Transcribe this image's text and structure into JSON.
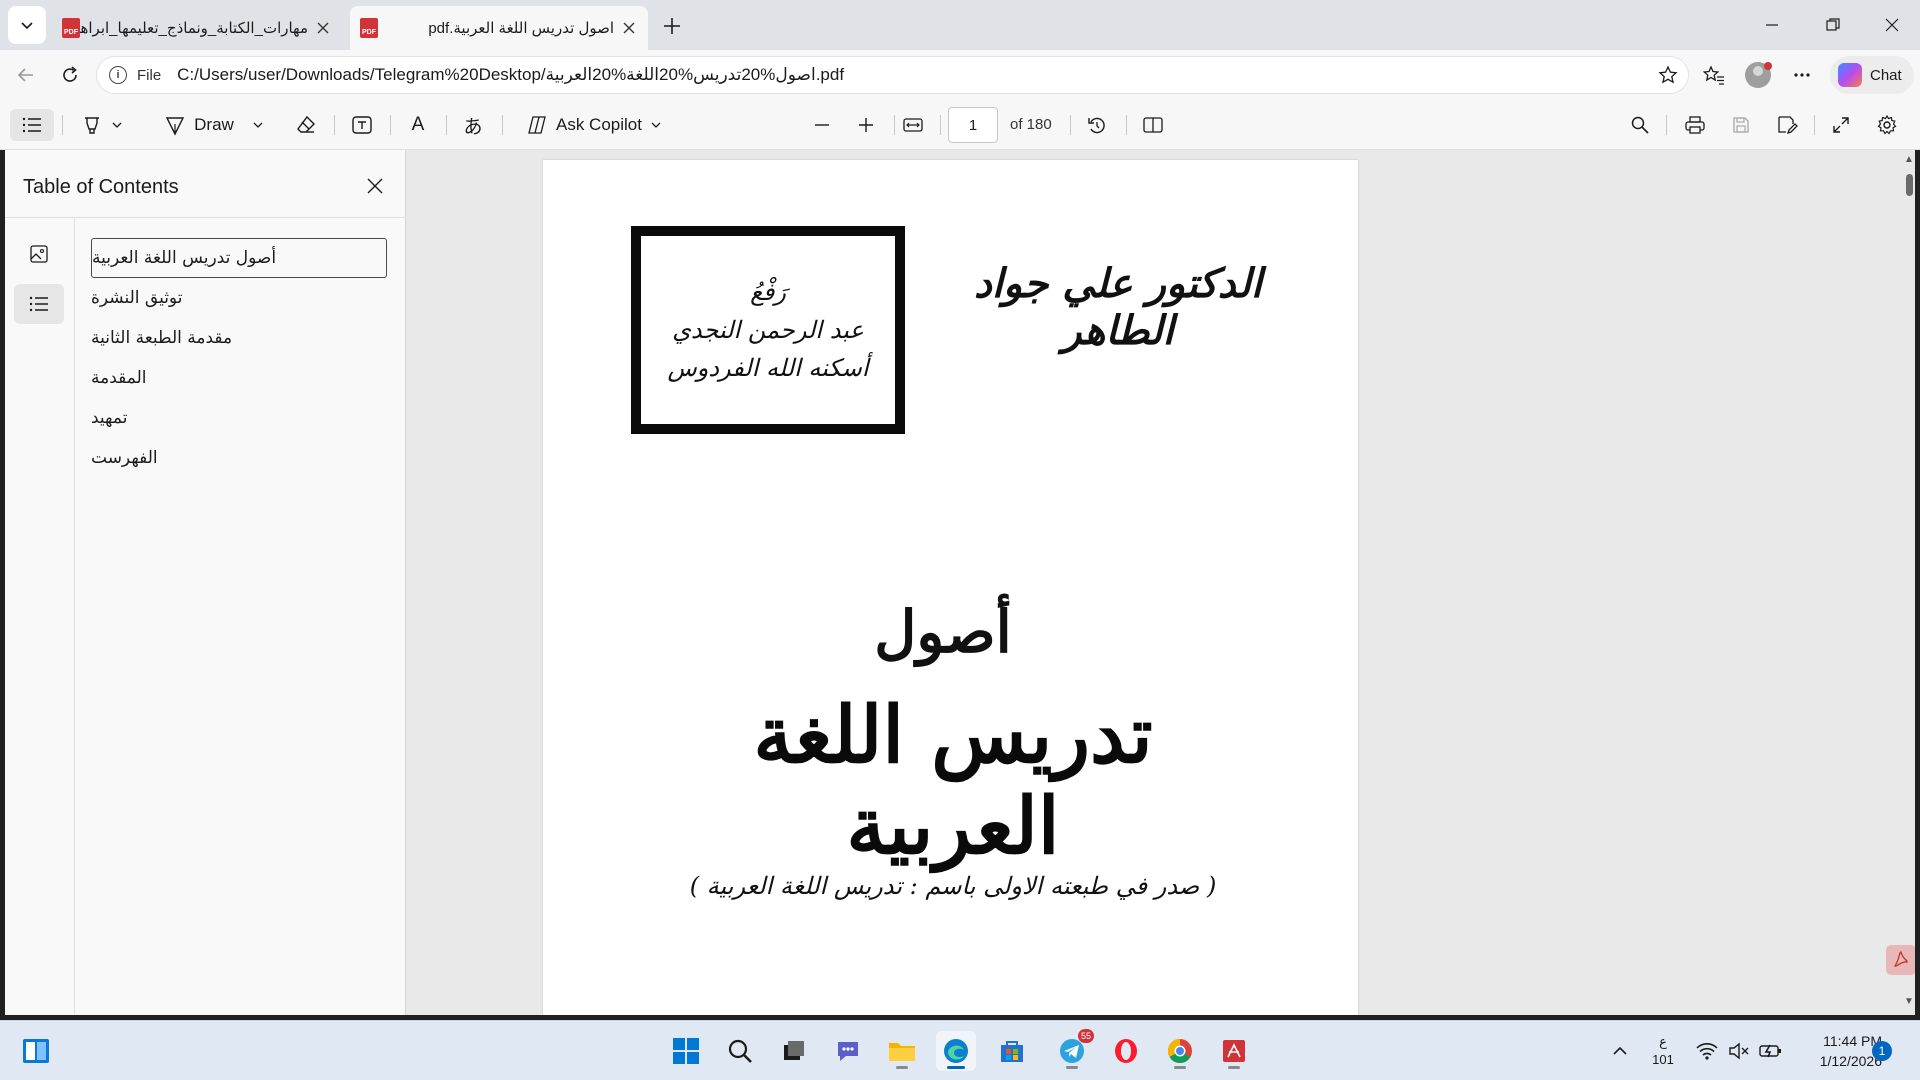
{
  "browser": {
    "tabs": [
      {
        "title": "مهارات_الكتابة_ونماذج_تعليمها_ابراهيم",
        "icon": "pdf-icon",
        "active": false
      },
      {
        "title": "اصول تدريس اللغة العربية.pdf",
        "icon": "pdf-icon",
        "active": true
      }
    ],
    "address": {
      "scheme_label": "File",
      "url": "C:/Users/user/Downloads/Telegram%20Desktop/اصول%20تدريس%20اللغة%20العربية.pdf"
    },
    "chat_label": "Chat"
  },
  "pdf_toolbar": {
    "draw_label": "Draw",
    "copilot_label": "Ask Copilot",
    "page_current": "1",
    "page_total_label": "of 180",
    "font_text_icon_label": "A",
    "translate_icon_label": "あ"
  },
  "toc": {
    "title": "Table of Contents",
    "items": [
      {
        "label": "أصول تدريس اللغة العربية",
        "selected": true
      },
      {
        "label": "توثيق النشرة",
        "selected": false
      },
      {
        "label": "مقدمة الطبعة الثانية",
        "selected": false
      },
      {
        "label": "المقدمة",
        "selected": false
      },
      {
        "label": "تمهيد",
        "selected": false
      },
      {
        "label": "الفهرست",
        "selected": false
      }
    ]
  },
  "document": {
    "stamp_lines": [
      "رَفْعُ",
      "عبد الرحمن النجدي",
      "أسكنه الله الفردوس"
    ],
    "author": "الدكتور علي جواد الطاهر",
    "title_top": "أصول",
    "title_main": "تدريس اللغة العربية",
    "subtitle": "( صدر في طبعته الاولى باسم : تدريس اللغة العربية )"
  },
  "taskbar": {
    "badge_telegram": "55",
    "tray_lang_top": "ع",
    "tray_lang_bottom": "101",
    "clock_time": "11:44 PM",
    "clock_date": "1/12/2026",
    "notification_count": "1"
  },
  "colors": {
    "accent": "#0067c0",
    "pdf_red": "#d13438",
    "tabstrip_bg": "#dfe3e8",
    "toolbar_bg": "#f7f7f7",
    "viewer_bg": "#e9e9e9"
  }
}
